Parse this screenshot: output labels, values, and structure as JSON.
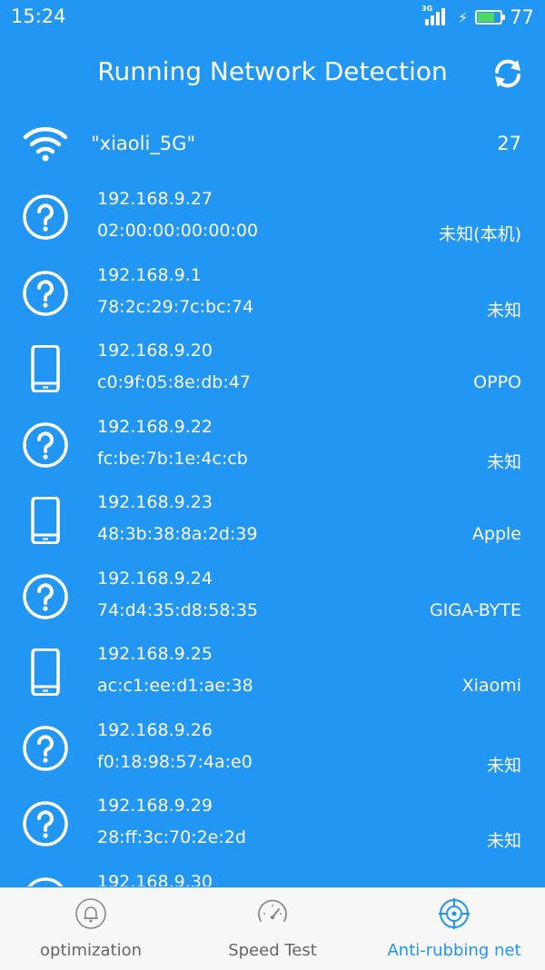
{
  "status_bar": {
    "time": "15:24",
    "network_type": "3G",
    "battery_level": "77",
    "battery_fraction": 0.77
  },
  "header": {
    "title": "Running Network Detection",
    "refresh_icon": "refresh-icon"
  },
  "network": {
    "name": "\"xiaoli_5G\"",
    "count": "27",
    "icon": "wifi-icon"
  },
  "devices": [
    {
      "icon": "unknown-device-icon",
      "ip": "192.168.9.27",
      "mac": "02:00:00:00:00:00",
      "vendor": "未知(本机)"
    },
    {
      "icon": "unknown-device-icon",
      "ip": "192.168.9.1",
      "mac": "78:2c:29:7c:bc:74",
      "vendor": "未知"
    },
    {
      "icon": "phone-icon",
      "ip": "192.168.9.20",
      "mac": "c0:9f:05:8e:db:47",
      "vendor": "OPPO"
    },
    {
      "icon": "unknown-device-icon",
      "ip": "192.168.9.22",
      "mac": "fc:be:7b:1e:4c:cb",
      "vendor": "未知"
    },
    {
      "icon": "phone-icon",
      "ip": "192.168.9.23",
      "mac": "48:3b:38:8a:2d:39",
      "vendor": "Apple"
    },
    {
      "icon": "unknown-device-icon",
      "ip": "192.168.9.24",
      "mac": "74:d4:35:d8:58:35",
      "vendor": "GIGA-BYTE"
    },
    {
      "icon": "phone-icon",
      "ip": "192.168.9.25",
      "mac": "ac:c1:ee:d1:ae:38",
      "vendor": "Xiaomi"
    },
    {
      "icon": "unknown-device-icon",
      "ip": "192.168.9.26",
      "mac": "f0:18:98:57:4a:e0",
      "vendor": "未知"
    },
    {
      "icon": "unknown-device-icon",
      "ip": "192.168.9.29",
      "mac": "28:ff:3c:70:2e:2d",
      "vendor": "未知"
    },
    {
      "icon": "unknown-device-icon",
      "ip": "192.168.9.30",
      "mac": "",
      "vendor": ""
    }
  ],
  "bottom_nav": {
    "tabs": [
      {
        "label": "optimization",
        "icon": "bell-icon",
        "active": false
      },
      {
        "label": "Speed Test",
        "icon": "speedometer-icon",
        "active": false
      },
      {
        "label": "Anti-rubbing net",
        "icon": "target-icon",
        "active": true
      }
    ]
  },
  "colors": {
    "background": "#2196f3",
    "active_tab": "#2196f3",
    "inactive_tab": "#666666",
    "nav_background": "#f7f7f7",
    "battery_fill": "#4cd964"
  }
}
